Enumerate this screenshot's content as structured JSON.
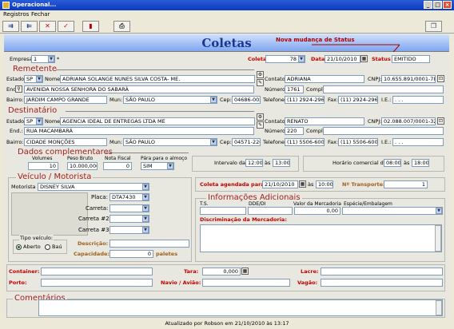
{
  "window": {
    "title": "Operacional...",
    "min": "_",
    "max": "□",
    "close": "×"
  },
  "menu": [
    "Registros",
    "Fechar"
  ],
  "toolbar": {
    "icons": [
      "add-icon",
      "edit-icon",
      "delete-icon",
      "confirm-icon",
      "calculator-icon",
      "print-icon",
      "copy-icon"
    ]
  },
  "banner": {
    "title": "Coletas"
  },
  "annotation": {
    "text": "Nova mudança de Status"
  },
  "header_row": {
    "empresa_label": "Empresa",
    "empresa_value": "1",
    "asterisk": "*",
    "coleta_label": "Coleta",
    "coleta_value": "78",
    "data_label": "Data",
    "data_value": "21/10/2010",
    "status_label": "Status",
    "status_value": "EMITIDO"
  },
  "remetente": {
    "title": "Remetente",
    "estado_label": "Estado:",
    "estado": "SP",
    "nome_label": "Nome:",
    "nome": "ADRIANA SOLANGE NUNES SILVA COSTA- ME.",
    "contato_label": "Contato:",
    "contato": "ADRIANA",
    "cnpj_label": "CNPJ:",
    "cnpj": "10.655.891/0001-78",
    "end_label": "End.:",
    "end": "AVENIDA NOSSA SENHORA DO SABARÁ",
    "numero_label": "Número:",
    "numero": "1761",
    "compl_label": "Compl.:",
    "compl": "",
    "bairro_label": "Bairro:",
    "bairro": "JARDIM CAMPO GRANDE",
    "mun_label": "Mun:",
    "mun": "SÃO PAULO",
    "cep_label": "Cep:",
    "cep": "04686-002",
    "telefone_label": "Telefone:",
    "telefone": "(11) 2924-2961",
    "fax_label": "Fax:",
    "fax": "(11) 2924-2964",
    "ie_label": "I.E.:",
    "ie": ".   .   ."
  },
  "destinatario": {
    "title": "Destinatário",
    "estado_label": "Estado:",
    "estado": "SP",
    "nome_label": "Nome:",
    "nome": "AGENCIA IDEAL DE ENTREGAS LTDA ME",
    "contato_label": "Contato:",
    "contato": "RENATO",
    "cnpj_label": "CNPJ:",
    "cnpj": "02.088.007/0001-32",
    "end_label": "End.:",
    "end": "RUA MACAMBARÁ",
    "numero_label": "Número:",
    "numero": "220",
    "compl_label": "Compl.:",
    "compl": "",
    "bairro_label": "Bairro:",
    "bairro": "CIDADE MONÇÕES",
    "mun_label": "Mun:",
    "mun": "SÃO PAULO",
    "cep_label": "Cep:",
    "cep": "04571-220",
    "telefone_label": "Telefone:",
    "telefone": "(11) 5506-6003",
    "fax_label": "Fax:",
    "fax": "(11) 5506-6003",
    "ie_label": "I.E.:",
    "ie": ".   .   ."
  },
  "complementares": {
    "title": "Dados complementares",
    "volumes_label": "Volumes",
    "volumes": "10",
    "peso_label": "Peso Bruto",
    "peso": "10.000,000",
    "nota_label": "Nota Fiscal",
    "nota": "0",
    "almoco_label": "Pára para o almoço",
    "almoco": "SIM",
    "intervalo_label": "Intervalo das",
    "intervalo_de": "12:00",
    "as1": "às",
    "intervalo_ate": "13:00",
    "comercial_label": "Horário comercial das",
    "comercial_de": "08:00",
    "as2": "às",
    "comercial_ate": "18:00"
  },
  "veiculo": {
    "title": "Veículo / Motorista",
    "motorista_label": "Motorista",
    "motorista": "DISNEY SILVA",
    "placa_label": "Placa:",
    "placa": "DTA7430",
    "carreta_label": "Carreta:",
    "carreta": "",
    "carreta2_label": "Carreta #2:",
    "carreta2": "",
    "carreta3_label": "Carreta #3:",
    "carreta3": "",
    "descricao_label": "Descrição:",
    "descricao": "",
    "capacidade_label": "Capacidade:",
    "capacidade": "0",
    "capacidade_unit": "paletes",
    "tipo_title": "Tipo veículo:",
    "tipo_aberto": "Aberto",
    "tipo_bau": "Baú"
  },
  "agendamento": {
    "label": "Coleta agendada para:",
    "data": "21/10/2010",
    "as": "às",
    "hora": "10:00",
    "transporte_label": "Nº Transporte:",
    "transporte": "1"
  },
  "info": {
    "title": "Informações Adicionais",
    "ts_label": "T.S.",
    "ddd_label": "DDE/DI",
    "valor_label": "Valor da Mercadoria",
    "especie_label": "Espécie/Embalagem",
    "ts": "",
    "ddd": "",
    "valor": "0,00",
    "especie": "",
    "discriminacao_label": "Discriminação da Mercadoria:"
  },
  "bottom": {
    "container_label": "Container:",
    "container": "",
    "tara_label": "Tara:",
    "tara": "0,000",
    "lacre_label": "Lacre:",
    "lacre": "",
    "porto_label": "Porto:",
    "porto": "",
    "navio_label": "Navio / Avião:",
    "navio": "",
    "vagao_label": "Vagão:",
    "vagao": ""
  },
  "comentarios": {
    "title": "Comentários",
    "text": ""
  },
  "footer": {
    "text": "Atualizado por Robson em 21/10/2010 às 13:17"
  }
}
